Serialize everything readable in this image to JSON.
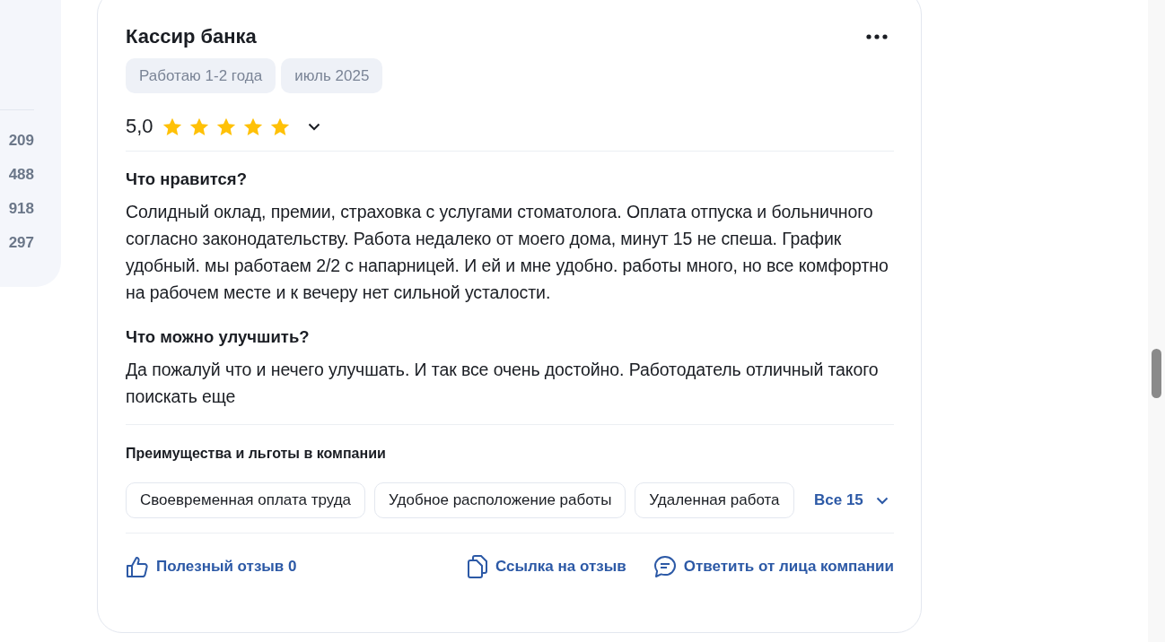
{
  "sidebar": {
    "counts": [
      "209",
      "488",
      "918",
      "297"
    ]
  },
  "review": {
    "title": "Кассир банка",
    "tags": [
      "Работаю 1-2 года",
      "июль 2025"
    ],
    "rating": {
      "value": "5,0",
      "stars": 5
    },
    "sections": [
      {
        "heading": "Что нравится?",
        "text": "Солидный оклад, премии, страховка с услугами стоматолога. Оплата отпуска и больничного согласно законодательству. Работа недалеко от моего дома, минут 15 не спеша. График удобный. мы работаем 2/2 с напарницей. И ей и мне удобно. работы много, но все комфортно на рабочем месте и к вечеру нет сильной усталости."
      },
      {
        "heading": "Что можно улучшить?",
        "text": "Да пожалуй что и нечего улучшать. И так все очень достойно. Работодатель отличный такого поискать еще"
      }
    ],
    "benefits": {
      "heading": "Преимущества и льготы в компании",
      "items": [
        "Своевременная оплата труда",
        "Удобное расположение работы",
        "Удаленная работа"
      ],
      "more": "Все 15"
    },
    "actions": [
      {
        "kind": "like",
        "label": "Полезный отзыв 0"
      },
      {
        "kind": "copy",
        "label": "Ссылка на отзыв"
      },
      {
        "kind": "reply",
        "label": "Ответить от лица компании"
      }
    ]
  }
}
